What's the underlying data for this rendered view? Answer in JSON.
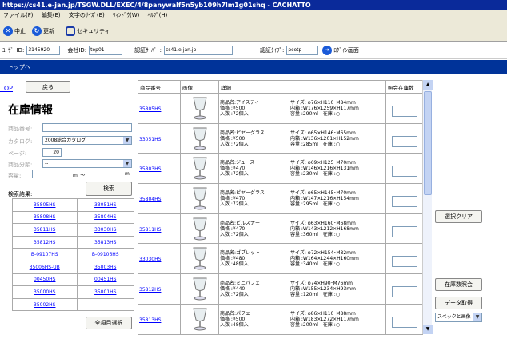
{
  "window": {
    "title": "https://cs41.e-jan.jp/TSGW.DLL/EXEC/4/8panywalf5n5yb109h7lm1g01shq - CACHATTO"
  },
  "menu": [
    "ファイル(F)",
    "編集(E)",
    "文字のｻｲｽﾞ(E)",
    "ｳｨﾝﾄﾞｳ(W)",
    "ﾍﾙﾌﾟ(H)"
  ],
  "toolbar": {
    "stop": "中止",
    "refresh": "更新",
    "security": "セキュリティ"
  },
  "form": {
    "user_label": "ﾕｰｻﾞｰID:",
    "user_value": "3145920",
    "company_label": "会社ID:",
    "company_value": "top01",
    "server_label": "認証ｻｰﾊﾞｰ:",
    "server_value": "cs41.e-jan.jp",
    "type_label": "認証ﾀｲﾌﾟ:",
    "type_value": "pcotp",
    "login_button": "ﾛｸﾞｲﾝ画面"
  },
  "nav": {
    "top_label": "トップへ"
  },
  "left": {
    "top_link": "TOP",
    "back_button": "戻る",
    "heading": "在庫情報",
    "fields": {
      "product_no_label": "商品番号:",
      "product_no_value": "",
      "catalog_label": "カタログ:",
      "catalog_value": "2008総合カタログ",
      "page_label": "ページ:",
      "page_value": "20",
      "category_label": "商品分類:",
      "category_value": "--",
      "capacity_label": "容量:",
      "capacity_unit1": "ml ～",
      "capacity_unit2": "ml"
    },
    "results_label": "検索結果:",
    "search_button": "検索",
    "results": [
      [
        "35805HS",
        "33051HS"
      ],
      [
        "35808HS",
        "35804HS"
      ],
      [
        "35811HS",
        "33030HS"
      ],
      [
        "35812HS",
        "35813HS"
      ],
      [
        "B-09107HS",
        "B-09106HS"
      ],
      [
        "35006HS-UB",
        "35003HS"
      ],
      [
        "00450HS",
        "00451HS"
      ],
      [
        "35000HS",
        "35001HS"
      ],
      [
        "35002HS",
        ""
      ]
    ],
    "select_all_button": "全項目選択"
  },
  "grid": {
    "headers": [
      "商品番号",
      "画像",
      "詳細",
      "",
      "照会在庫数"
    ],
    "rows": [
      {
        "code": "35805HS",
        "name": "商品名:アイスティー",
        "price": "価格 :¥500",
        "unit": "入数 :72個入",
        "size": "サイズ: φ76×H110･M84mm",
        "inner": "内箱 :W176×L259×H117mm",
        "cap": "容量 :290ml　在庫 :○"
      },
      {
        "code": "33051HS",
        "name": "商品名:ピヤーグラス",
        "price": "価格 :¥500",
        "unit": "入数 :72個入",
        "size": "サイズ: φ65×H146･M65mm",
        "inner": "内箱 :W136×L201×H152mm",
        "cap": "容量 :285ml　在庫 :○"
      },
      {
        "code": "35803HS",
        "name": "商品名:ジュース",
        "price": "価格 :¥470",
        "unit": "入数 :72個入",
        "size": "サイズ: φ69×H125･M70mm",
        "inner": "内箱 :W146×L216×H131mm",
        "cap": "容量 :230ml　在庫 :○"
      },
      {
        "code": "35804HS",
        "name": "商品名:ピヤーグラス",
        "price": "価格 :¥470",
        "unit": "入数 :72個入",
        "size": "サイズ: φ65×H145･M70mm",
        "inner": "内箱 :W147×L216×H154mm",
        "cap": "容量 :295ml　在庫 :○"
      },
      {
        "code": "35811HS",
        "name": "商品名:ビルスナー",
        "price": "価格 :¥470",
        "unit": "入数 :72個入",
        "size": "サイズ: φ63×H160･M68mm",
        "inner": "内箱 :W143×L212×H168mm",
        "cap": "容量 :360ml　在庫 :○"
      },
      {
        "code": "33030HS",
        "name": "商品名:ゴブレット",
        "price": "価格 :¥480",
        "unit": "入数 :48個入",
        "size": "サイズ: φ72×H154･M82mm",
        "inner": "内箱 :W164×L244×H160mm",
        "cap": "容量 :340ml　在庫 :○"
      },
      {
        "code": "35812HS",
        "name": "商品名:ミニパフェ",
        "price": "価格 :¥440",
        "unit": "入数 :72個入",
        "size": "サイズ: φ74×H90･M76mm",
        "inner": "内箱 :W155×L234×H93mm",
        "cap": "容量 :120ml　在庫 :○"
      },
      {
        "code": "35813HS",
        "name": "商品名:パフェ",
        "price": "価格 :¥500",
        "unit": "入数 :48個入",
        "size": "サイズ: φ86×H110･M88mm",
        "inner": "内箱 :W183×L272×H117mm",
        "cap": "容量 :200ml　在庫 :○"
      }
    ]
  },
  "right": {
    "clear_button": "選択クリア",
    "inquiry_button": "在庫数照会",
    "fetch_button": "データ取得",
    "spec_select": "スペックと画像"
  }
}
